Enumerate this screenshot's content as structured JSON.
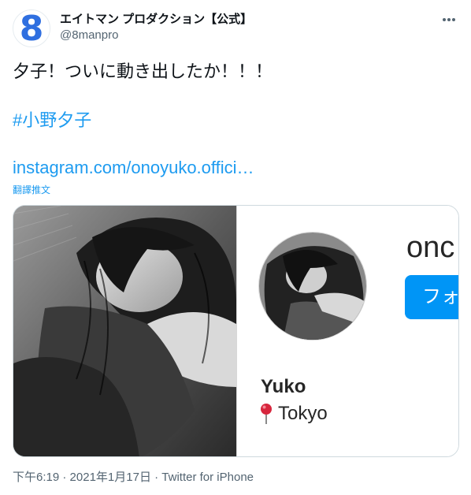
{
  "tweet": {
    "avatar_glyph": "8",
    "display_name": "エイトマン プロダクション【公式】",
    "handle": "@8manpro",
    "text": "夕子！ついに動き出したか！！！",
    "hashtag": "#小野夕子",
    "link": "instagram.com/onoyuko.offici…",
    "translate": "翻譯推文"
  },
  "card": {
    "username_partial": "onc",
    "follow_label": "フォ",
    "name": "Yuko",
    "location": "Tokyo"
  },
  "meta": {
    "time": "下午6:19",
    "separator": " · ",
    "date": "2021年1月17日",
    "source": "Twitter for iPhone"
  },
  "colors": {
    "accent": "#1d9bf0",
    "secondary_text": "#536471",
    "follow_button": "#0095f6",
    "avatar_brand": "#2f6fe0"
  }
}
